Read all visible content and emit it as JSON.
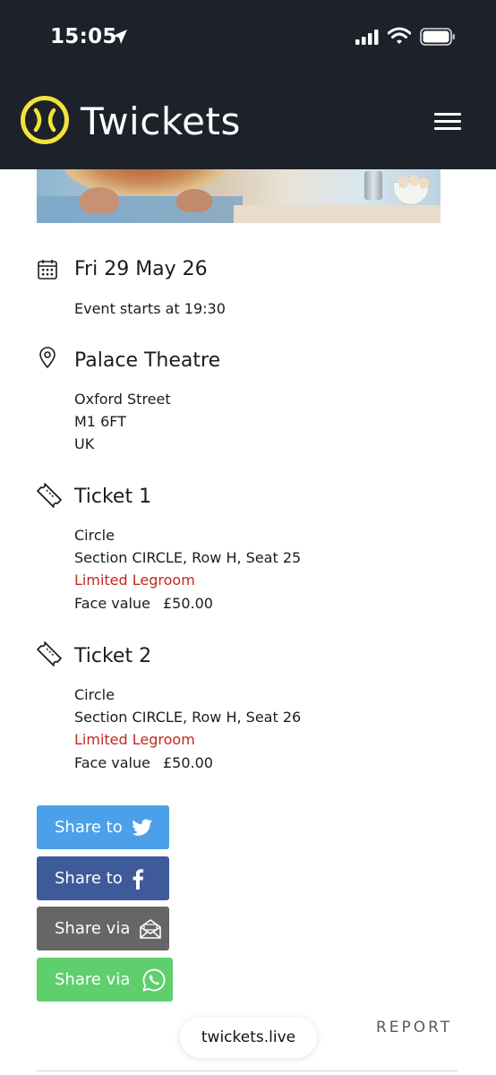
{
  "status_bar": {
    "time": "15:05"
  },
  "header": {
    "brand": "Twickets"
  },
  "event": {
    "date": "Fri 29 May 26",
    "start_text": "Event starts at 19:30"
  },
  "venue": {
    "name": "Palace Theatre",
    "address": [
      "Oxford Street",
      "M1 6FT",
      "UK"
    ]
  },
  "tickets": [
    {
      "title": "Ticket 1",
      "area": "Circle",
      "seat": "Section CIRCLE, Row H, Seat 25",
      "note": "Limited Legroom",
      "face_value_label": "Face value",
      "face_value": "£50.00"
    },
    {
      "title": "Ticket 2",
      "area": "Circle",
      "seat": "Section CIRCLE, Row H, Seat 26",
      "note": "Limited Legroom",
      "face_value_label": "Face value",
      "face_value": "£50.00"
    }
  ],
  "share": {
    "twitter": "Share to",
    "facebook": "Share to",
    "email": "Share via",
    "whatsapp": "Share via"
  },
  "footer": {
    "url": "twickets.live",
    "report": "REPORT"
  },
  "colors": {
    "header_bg": "#1d2129",
    "brand_yellow": "#f2e33a",
    "twitter": "#4aa1e8",
    "facebook": "#3e5a98",
    "email": "#666666",
    "whatsapp": "#5fcf6e",
    "alert_red": "#c2281e"
  },
  "icons": [
    "location-arrow-icon",
    "signal-icon",
    "wifi-icon",
    "battery-icon",
    "twickets-logo-icon",
    "hamburger-menu-icon",
    "calendar-icon",
    "map-pin-icon",
    "ticket-icon",
    "twitter-icon",
    "facebook-icon",
    "email-icon",
    "whatsapp-icon"
  ]
}
